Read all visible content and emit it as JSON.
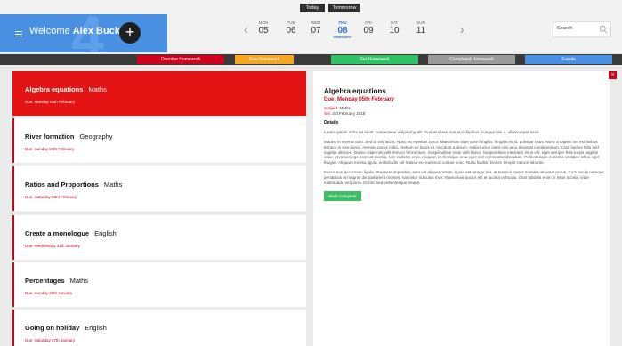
{
  "top_pills": {
    "today": "Today",
    "tomorrow": "Tommorow"
  },
  "header": {
    "big_glyph": "4",
    "welcome_prefix": "Welcome",
    "user_name": "Alex Buck",
    "add_label": "+"
  },
  "calendar": {
    "prev": "‹",
    "next": "›",
    "days": [
      {
        "name": "MON",
        "num": "05"
      },
      {
        "name": "TUE",
        "num": "06"
      },
      {
        "name": "WED",
        "num": "07"
      },
      {
        "name": "THU",
        "num": "08",
        "month": "FEBRUARY",
        "active": true
      },
      {
        "name": "FRI",
        "num": "09"
      },
      {
        "name": "SAT",
        "num": "10"
      },
      {
        "name": "SUN",
        "num": "11"
      }
    ]
  },
  "search": {
    "placeholder": "Search"
  },
  "filters": [
    {
      "label": "Overdue Homework",
      "color": "#d0021b"
    },
    {
      "label": "Due Homework",
      "color": "#f5a623"
    },
    {
      "label": "Set Homework",
      "color": "#2ec464"
    },
    {
      "label": "Completed Homework",
      "color": "#9b9b9b"
    },
    {
      "label": "Events",
      "color": "#4a90e2"
    }
  ],
  "homework": [
    {
      "title": "Algebra equations",
      "subject": "Maths",
      "due": "Due: Monday 05th February",
      "active": true
    },
    {
      "title": "River formation",
      "subject": "Geography",
      "due": "Due: Sunday 04th February"
    },
    {
      "title": "Ratios and Proportions",
      "subject": "Maths",
      "due": "Due: Saturday 03rd February"
    },
    {
      "title": "Create a monologue",
      "subject": "English",
      "due": "Due: Wednesday 31th January"
    },
    {
      "title": "Percentages",
      "subject": "Maths",
      "due": "Due: Sunday 28th January"
    },
    {
      "title": "Going on holiday",
      "subject": "English",
      "due": "Due: Saturday 27th January"
    }
  ],
  "detail": {
    "close": "×",
    "title": "Algebra equations",
    "due": "Due: Monday 05th February",
    "subject_key": "Subject:",
    "subject_val": "Maths",
    "set_key": "Set:",
    "set_val": "3rd February 2018",
    "details_heading": "Details",
    "para1": "Lorem ipsum dolor sit amet, consectetur adipiscing elit. Suspendisse non orci dapibus, congue nisi a, ullamcorper risus.",
    "para2": "Mauris in viverra odio. Sed id nisi lacus. Nunc eu egestas tortor. Maecenas vitae ante fringilla, fringilla ex id, pulvinar risus. Nunc a sapien vel est finibus tempor in non purus. Aenean purus nulla, pretium ac lacus et, tincidunt a ipsum. Nulla luctus justo non arcu placerat condimentum. Cras sed ex felis sed sagittis ultricies. Donec vitae nisi velit tempor fermentum. Suspendisse vitae velit libero. Suspendisse interdum risus vel, eget semper felis turpis sagittis vitae. Vivamus eget laoreet massa, non sodales eros. Aliquam scelerisque arcu eget nisl commodo bibendum. Pellentesque molestie sodales tellus eget feugiat. Aliquam massa ligula, sollicitudin vel massa eu, euismod cursus nunc. Nulla facilisi. Donec tempor rutrum lobortis.",
    "para3": "Fusce non accumsan ligula. Praesent imperdiet, sem vel aliquet rutrum, ligula est tempor leo, at tempus metus sodales sit amet purus. Cum sociis natoque penatibus et magnis dis parturient montes, nascetur ridiculus mus. Maecenas auctor elit et lacinia vehicula. Cras lobortis enim in risus lacinia, vitae malesuada est porta. Donec sed pellentesque neque.",
    "mark_complete": "Mark Complete"
  }
}
